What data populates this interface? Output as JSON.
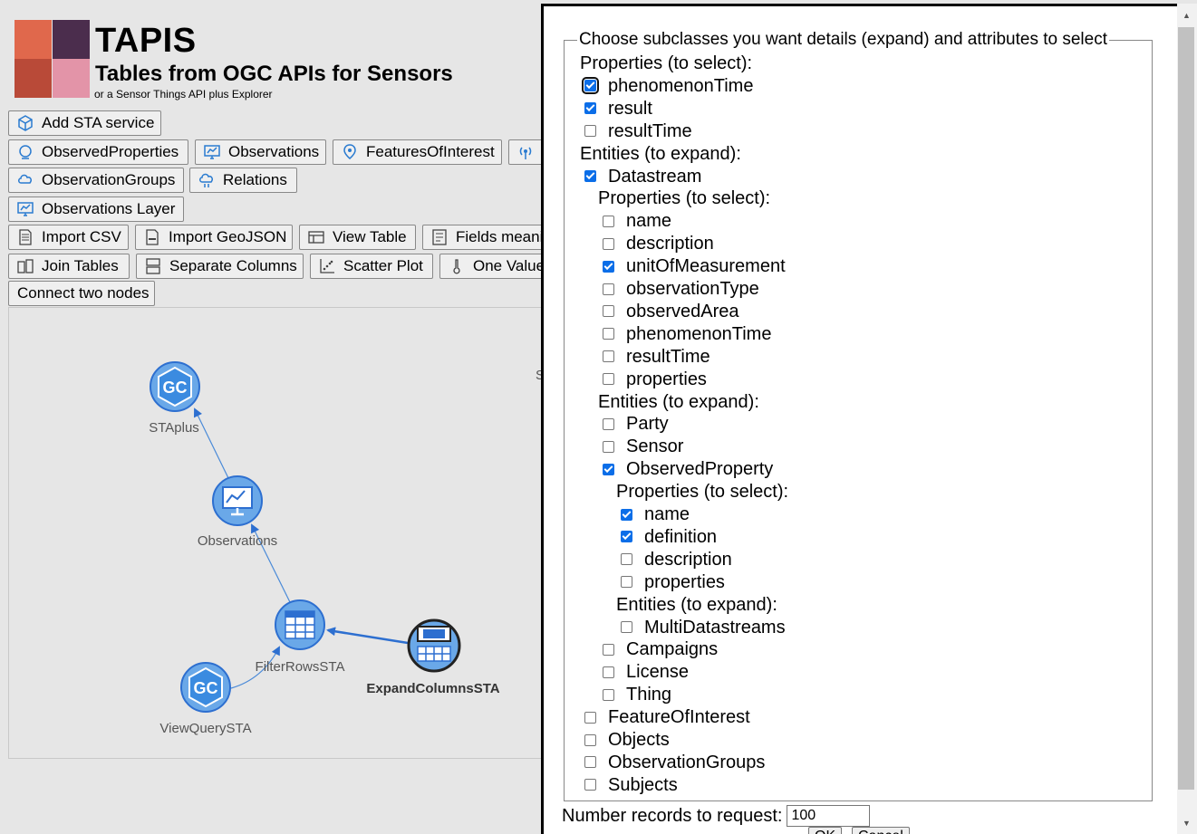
{
  "app": {
    "title": "TAPIS",
    "subtitle": "Tables from OGC APIs for Sensors",
    "tagline": "or a Sensor Things API plus Explorer",
    "logo_colors": [
      "#e86a4e",
      "#4a2a4a",
      "#c0503a",
      "#e08aa0"
    ]
  },
  "toolbar": {
    "add_sta": "Add STA service",
    "observed_properties": "ObservedProperties",
    "observations": "Observations",
    "features_of_interest": "FeaturesOfInterest",
    "observation_groups": "ObservationGroups",
    "relations": "Relations",
    "observations_layer": "Observations Layer",
    "import_csv": "Import CSV",
    "import_geojson": "Import GeoJSON",
    "view_table": "View Table",
    "fields_meaning": "Fields meani",
    "join_tables": "Join Tables",
    "separate_columns": "Separate Columns",
    "scatter_plot": "Scatter Plot",
    "one_value": "One Value",
    "connect_nodes": "Connect two nodes"
  },
  "graph": {
    "nodes": {
      "staplus": "STAplus",
      "observations": "Observations",
      "filter_rows": "FilterRowsSTA",
      "expand_columns": "ExpandColumnsSTA",
      "view_query": "ViewQuerySTA"
    },
    "partial_label": "S"
  },
  "dialog": {
    "legend": "Choose subclasses you want details (expand) and attributes to select",
    "props_header": "Properties (to select):",
    "entities_header": "Entities (to expand):",
    "root_props": [
      {
        "label": "phenomenonTime",
        "checked": true
      },
      {
        "label": "result",
        "checked": true
      },
      {
        "label": "resultTime",
        "checked": false
      }
    ],
    "datastream": {
      "label": "Datastream",
      "checked": true
    },
    "datastream_props": [
      {
        "label": "name",
        "checked": false
      },
      {
        "label": "description",
        "checked": false
      },
      {
        "label": "unitOfMeasurement",
        "checked": true
      },
      {
        "label": "observationType",
        "checked": false
      },
      {
        "label": "observedArea",
        "checked": false
      },
      {
        "label": "phenomenonTime",
        "checked": false
      },
      {
        "label": "resultTime",
        "checked": false
      },
      {
        "label": "properties",
        "checked": false
      }
    ],
    "datastream_entities": [
      {
        "label": "Party",
        "checked": false
      },
      {
        "label": "Sensor",
        "checked": false
      },
      {
        "label": "ObservedProperty",
        "checked": true
      }
    ],
    "obsprop_props": [
      {
        "label": "name",
        "checked": true
      },
      {
        "label": "definition",
        "checked": true
      },
      {
        "label": "description",
        "checked": false
      },
      {
        "label": "properties",
        "checked": false
      }
    ],
    "obsprop_entities": [
      {
        "label": "MultiDatastreams",
        "checked": false
      }
    ],
    "datastream_entities_2": [
      {
        "label": "Campaigns",
        "checked": false
      },
      {
        "label": "License",
        "checked": false
      },
      {
        "label": "Thing",
        "checked": false
      }
    ],
    "root_entities_2": [
      {
        "label": "FeatureOfInterest",
        "checked": false
      },
      {
        "label": "Objects",
        "checked": false
      },
      {
        "label": "ObservationGroups",
        "checked": false
      },
      {
        "label": "Subjects",
        "checked": false
      }
    ],
    "num_records_label": "Number records to request:",
    "num_records_value": "100",
    "ok_label": "OK",
    "cancel_label": "Cancel"
  }
}
